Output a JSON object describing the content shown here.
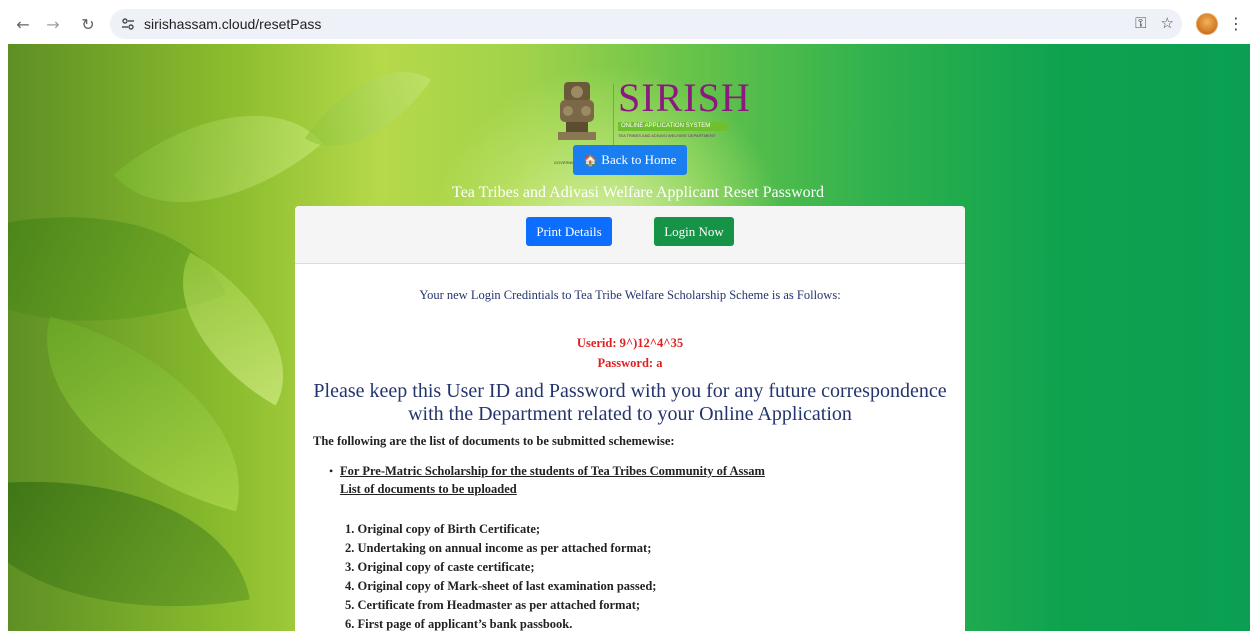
{
  "browser": {
    "url": "sirishassam.cloud/resetPass",
    "back_icon": "arrow-left-icon",
    "forward_icon": "arrow-right-icon",
    "reload_icon": "reload-icon",
    "site_info_icon": "tune-icon",
    "password_icon": "key-icon",
    "bookmark_icon": "star-icon",
    "menu_icon": "more-vert-icon"
  },
  "logo": {
    "title": "SIRISH",
    "band_text": "ONLINE APPLICATION SYSTEM",
    "subtitle": "TEA TRIBES AND ADIVASI WELFARE DEPARTMENT",
    "dept": "GOVERNMENT OF ASSAM"
  },
  "header": {
    "home_button": "Back to Home",
    "heading": "Tea Tribes and Adivasi Welfare Applicant Reset Password"
  },
  "actions": {
    "print": "Print Details",
    "login": "Login Now"
  },
  "content": {
    "intro": "Your new Login Credintials to Tea Tribe Welfare Scholarship Scheme is as Follows:",
    "userid": "Userid: 9^)12^4^35",
    "password": "Password: a",
    "keep_line1": "Please keep this User ID and Password with you for any future correspondence",
    "keep_line2": "with the Department related to your Online Application",
    "docs_title": "The following are the list of documents to be submitted schemewise:",
    "scheme_title": "For Pre-Matric Scholarship for the students of Tea Tribes Community of Assam",
    "scheme_sub": "List of documents to be uploaded",
    "documents": [
      "1. Original copy of Birth Certificate;",
      "2. Undertaking on annual income as per attached format;",
      "3. Original copy of caste certificate;",
      "4. Original copy of Mark-sheet of last examination passed;",
      "5. Certificate from Headmaster as per attached format;",
      "6. First page of applicant’s bank passbook."
    ]
  },
  "colors": {
    "primary_blue": "#0d6efd",
    "success_green": "#159447",
    "credential_red": "#e02020",
    "text_navy": "#24356e",
    "brand_purple": "#8a1a7e"
  }
}
